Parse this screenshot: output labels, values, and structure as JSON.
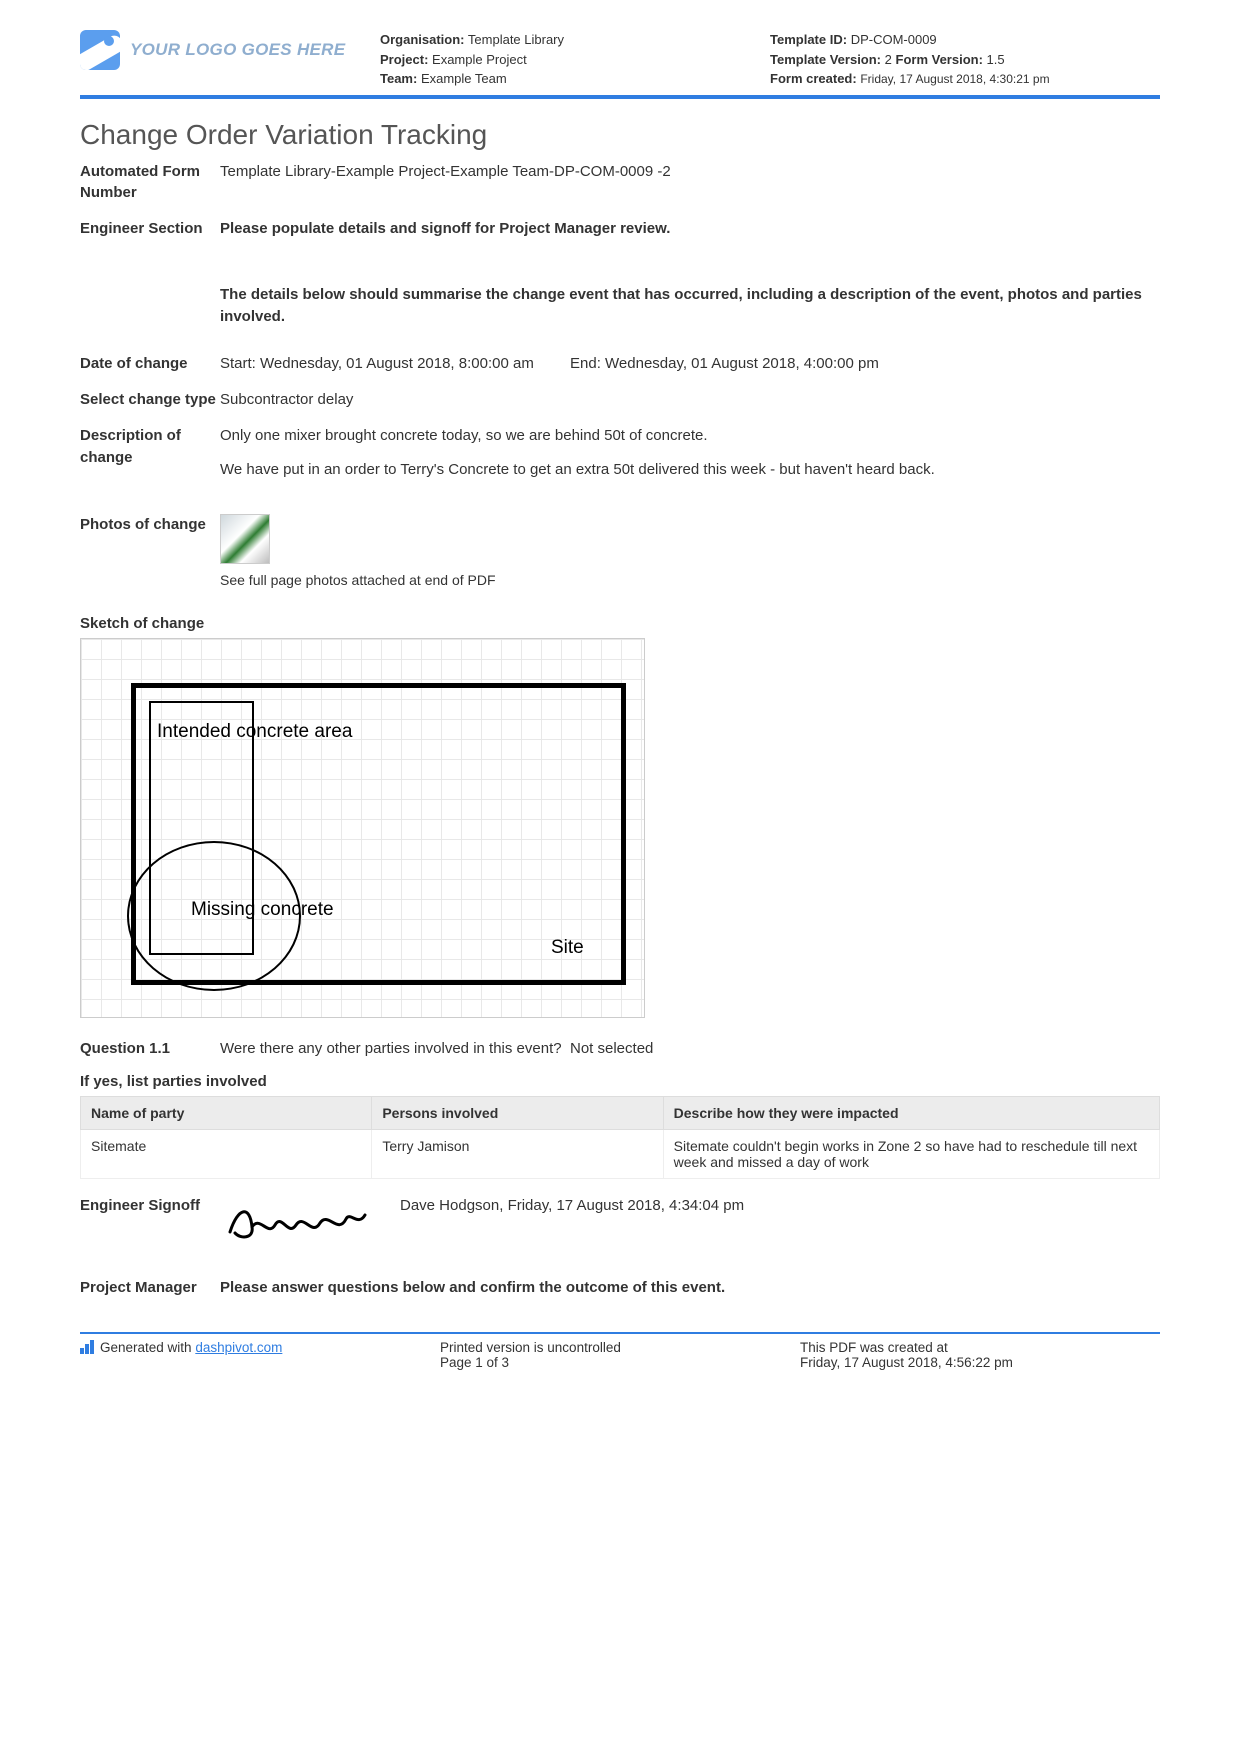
{
  "header": {
    "logo_text": "YOUR LOGO GOES HERE",
    "org_label": "Organisation:",
    "org_value": "Template Library",
    "project_label": "Project:",
    "project_value": "Example Project",
    "team_label": "Team:",
    "team_value": "Example Team",
    "template_id_label": "Template ID:",
    "template_id_value": "DP-COM-0009",
    "template_ver_label": "Template Version:",
    "template_ver_value": "2",
    "form_ver_label": "Form Version:",
    "form_ver_value": "1.5",
    "form_created_label": "Form created:",
    "form_created_value": "Friday, 17 August 2018, 4:30:21 pm"
  },
  "title": "Change Order Variation Tracking",
  "fields": {
    "form_number_label": "Automated Form Number",
    "form_number_value": "Template Library-Example Project-Example Team-DP-COM-0009   -2",
    "engineer_section_label": "Engineer Section",
    "engineer_section_value": "Please populate details and signoff for Project Manager review.",
    "details_note": "The details below should summarise the change event that has occurred, including a description of the event, photos and parties involved.",
    "date_label": "Date of change",
    "date_start": "Start: Wednesday, 01 August 2018, 8:00:00 am",
    "date_end": "End: Wednesday, 01 August 2018, 4:00:00 pm",
    "type_label": "Select change type",
    "type_value": "Subcontractor delay",
    "desc_label": "Description of change",
    "desc_line1": "Only one mixer brought concrete today, so we are behind 50t of concrete.",
    "desc_line2": "We have put in an order to Terry's Concrete to get an extra 50t delivered this week - but haven't heard back.",
    "photos_label": "Photos of change",
    "photos_caption": "See full page photos attached at end of PDF",
    "sketch_label": "Sketch of change",
    "sketch_text1": "Intended concrete area",
    "sketch_text2": "Missing concrete",
    "sketch_text3": "Site",
    "q_label": "Question 1.1",
    "q_text": "Were there any other parties involved in this event?",
    "q_answer": "Not selected",
    "parties_label": "If yes, list parties involved",
    "th1": "Name of party",
    "th2": "Persons involved",
    "th3": "Describe how they were impacted",
    "td1": "Sitemate",
    "td2": "Terry Jamison",
    "td3": "Sitemate couldn't begin works in Zone 2 so have had to reschedule till next week and missed a day of work",
    "signoff_label": "Engineer Signoff",
    "signoff_text": "Dave Hodgson, Friday, 17 August 2018, 4:34:04 pm",
    "pm_label": "Project Manager",
    "pm_value": "Please answer questions below and confirm the outcome of this event."
  },
  "footer": {
    "generated_prefix": "Generated with ",
    "generated_link": "dashpivot.com",
    "uncontrolled": "Printed version is uncontrolled",
    "page": "Page 1 of 3",
    "created_label": "This PDF was created at",
    "created_value": "Friday, 17 August 2018, 4:56:22 pm"
  }
}
